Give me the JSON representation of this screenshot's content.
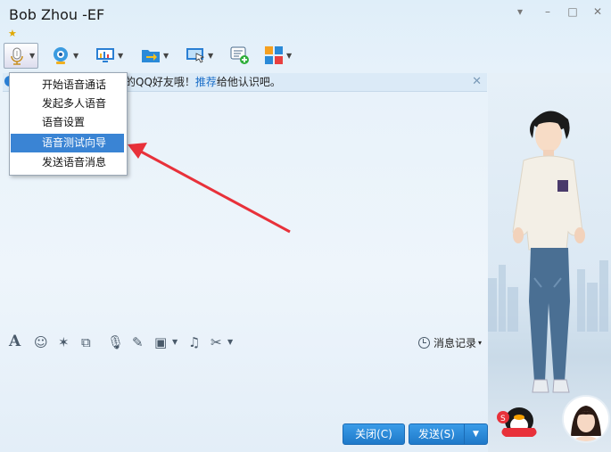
{
  "window": {
    "title": "Bob Zhou -EF",
    "star_glyph": "★",
    "controls": {
      "skin": "▾",
      "minimize": "–",
      "maximize": "□",
      "close": "✕"
    }
  },
  "toolbar": {
    "buttons": [
      {
        "name": "voice-call",
        "icon": "microphone-icon"
      },
      {
        "name": "video-call",
        "icon": "webcam-icon"
      },
      {
        "name": "remote-desktop",
        "icon": "monitor-chart-icon"
      },
      {
        "name": "send-file",
        "icon": "folder-arrow-icon"
      },
      {
        "name": "remote-assist",
        "icon": "screen-cursor-icon"
      },
      {
        "name": "create-discussion",
        "icon": "chat-add-icon"
      },
      {
        "name": "apps",
        "icon": "app-grid-icon"
      }
    ]
  },
  "notice": {
    "text_before": "的QQ好友哦！",
    "link": "推荐",
    "text_after": "给他认识吧。",
    "close": "✕"
  },
  "voice_menu": {
    "items": [
      {
        "label": "开始语音通话"
      },
      {
        "label": "发起多人语音"
      },
      {
        "label": "语音设置"
      },
      {
        "label": "语音测试向导",
        "active": true
      },
      {
        "label": "发送语音消息"
      }
    ]
  },
  "format_bar": {
    "history_label": "消息记录",
    "history_arrow": "▾",
    "icons": [
      "font-icon",
      "emoji-icon",
      "magic-icon",
      "screenshot-icon",
      "voice-msg-icon",
      "doodle-icon",
      "image-icon",
      "music-icon",
      "scissors-icon"
    ]
  },
  "actions": {
    "close_label": "关闭(C)",
    "send_label": "发送(S)",
    "send_dropdown": "▼"
  },
  "colors": {
    "accent": "#2a7fd4",
    "menu_highlight": "#3a84d4",
    "arrow": "#e8313a"
  }
}
